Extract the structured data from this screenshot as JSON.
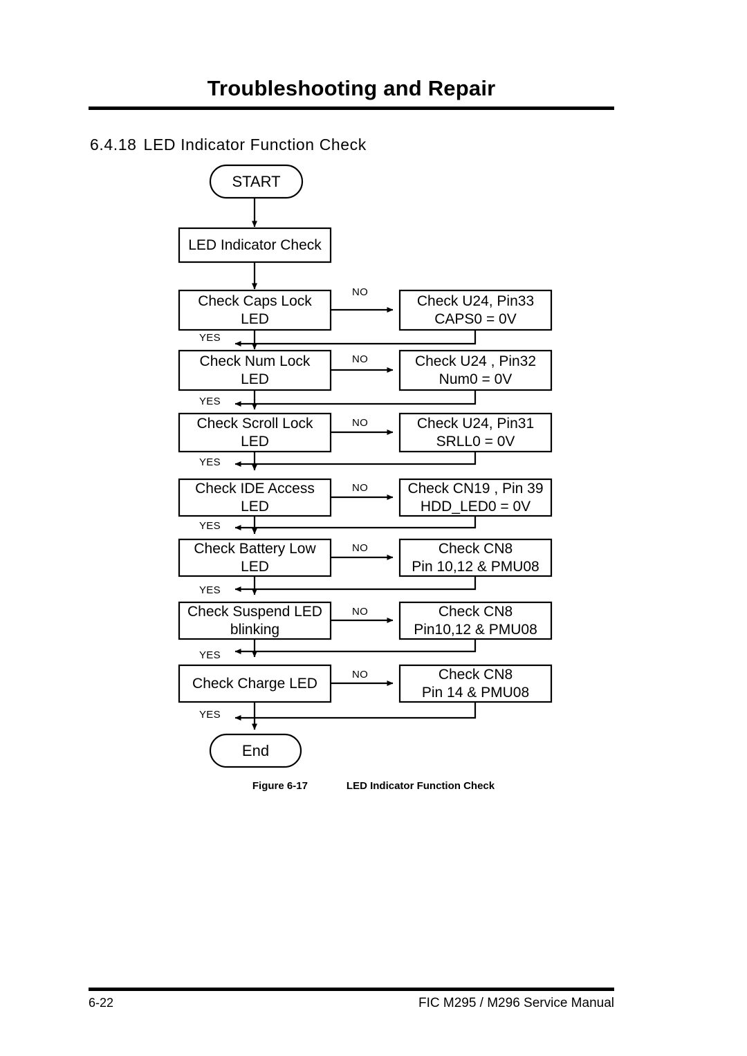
{
  "header": {
    "title": "Troubleshooting and Repair"
  },
  "section": {
    "number": "6.4.18",
    "title": "LED Indicator Function Check"
  },
  "flowchart": {
    "start_label": "START",
    "end_label": "End",
    "first_step": "LED Indicator Check",
    "yes_label": "YES",
    "no_label": "NO",
    "rows": [
      {
        "check_line1": "Check Caps Lock",
        "check_line2": "LED",
        "result_line1": "Check U24, Pin33",
        "result_line2": "CAPS0 = 0V"
      },
      {
        "check_line1": "Check Num Lock",
        "check_line2": "LED",
        "result_line1": "Check U24 , Pin32",
        "result_line2": "Num0 = 0V"
      },
      {
        "check_line1": "Check Scroll Lock",
        "check_line2": "LED",
        "result_line1": "Check U24, Pin31",
        "result_line2": "SRLL0 = 0V"
      },
      {
        "check_line1": "Check IDE Access",
        "check_line2": "LED",
        "result_line1": "Check CN19 , Pin 39",
        "result_line2": "HDD_LED0 = 0V"
      },
      {
        "check_line1": "Check Battery Low",
        "check_line2": "LED",
        "result_line1": "Check CN8",
        "result_line2": "Pin 10,12 & PMU08"
      },
      {
        "check_line1": "Check Suspend LED",
        "check_line2": "blinking",
        "result_line1": "Check CN8",
        "result_line2": "Pin10,12 & PMU08"
      },
      {
        "check_line1": "Check Charge LED",
        "check_line2": "",
        "result_line1": "Check CN8",
        "result_line2": "Pin 14 & PMU08"
      }
    ]
  },
  "figure": {
    "number": "Figure 6-17",
    "title": "LED Indicator Function Check"
  },
  "footer": {
    "page_number": "6-22",
    "manual": "FIC M295 / M296 Service Manual"
  }
}
